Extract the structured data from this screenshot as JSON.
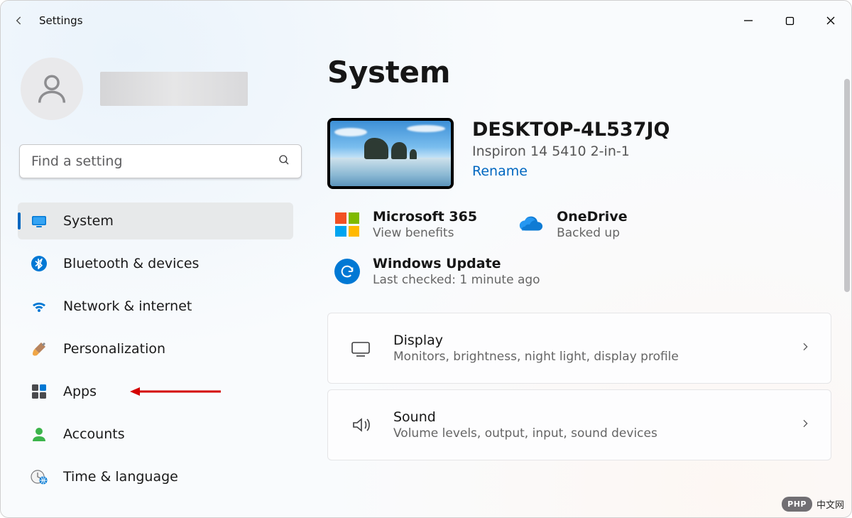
{
  "app": {
    "title": "Settings"
  },
  "search": {
    "placeholder": "Find a setting"
  },
  "nav": {
    "items": [
      {
        "label": "System"
      },
      {
        "label": "Bluetooth & devices"
      },
      {
        "label": "Network & internet"
      },
      {
        "label": "Personalization"
      },
      {
        "label": "Apps"
      },
      {
        "label": "Accounts"
      },
      {
        "label": "Time & language"
      }
    ]
  },
  "main": {
    "heading": "System",
    "pc": {
      "name": "DESKTOP-4L537JQ",
      "model": "Inspiron 14 5410 2-in-1",
      "rename": "Rename"
    },
    "status": {
      "m365": {
        "title": "Microsoft 365",
        "sub": "View benefits"
      },
      "onedrive": {
        "title": "OneDrive",
        "sub": "Backed up"
      },
      "update": {
        "title": "Windows Update",
        "sub": "Last checked: 1 minute ago"
      }
    },
    "cards": [
      {
        "title": "Display",
        "sub": "Monitors, brightness, night light, display profile"
      },
      {
        "title": "Sound",
        "sub": "Volume levels, output, input, sound devices"
      }
    ]
  },
  "watermark": {
    "badge": "PHP",
    "text": "中文网"
  }
}
